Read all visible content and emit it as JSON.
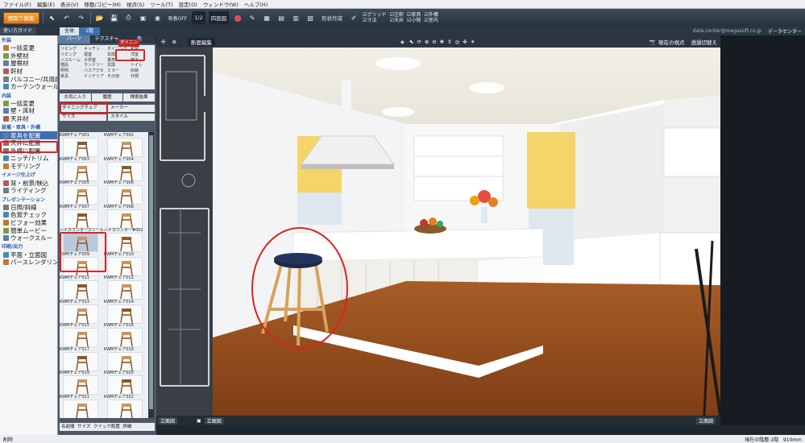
{
  "menu": [
    "ファイル(F)",
    "編集(E)",
    "表示(V)",
    "移動/コピー(M)",
    "視点(S)",
    "ツール(T)",
    "設定(O)",
    "ウィンドウ(W)",
    "ヘルプ(H)"
  ],
  "toolbar": {
    "plan_edit_button": "間取り編集",
    "grid_toggle": "吸着OFF",
    "scale": "1/2",
    "view_mode": "四面図",
    "shape_create": "形状作成",
    "display_options": [
      "グリッド",
      "注釈",
      "家具",
      "外構",
      "寸法",
      "天井",
      "小物",
      "室内"
    ]
  },
  "subbar": {
    "guide": "使い方ガイド",
    "tabs": [
      "全体",
      "1階"
    ],
    "email": "data.center@megasoft.co.jp",
    "data_center": "データセンター"
  },
  "leftnav": {
    "sections": [
      {
        "title": "外装",
        "items": [
          "一括変更",
          "外壁材",
          "屋根材",
          "軒材",
          "バルコニー/共用廊下",
          "カーテンウォール"
        ]
      },
      {
        "title": "内装",
        "items": [
          "一括変更",
          "壁・床材",
          "天井材"
        ]
      },
      {
        "title": "設備・家具・外構",
        "items": [
          "家具を配置",
          "天井に配置",
          "外構に配置",
          "ニッチ/トリム",
          "モデリング"
        ]
      },
      {
        "title": "イメージ仕上げ",
        "items": [
          "背・前景/映込",
          "ライティング"
        ]
      },
      {
        "title": "プレゼンテーション",
        "items": [
          "日照/斜線",
          "色覚チェック",
          "ビフォー効果",
          "簡単ムービー",
          "ウォークスルー"
        ]
      },
      {
        "title": "印刷/出力",
        "items": [
          "平面・立面図",
          "パースレンダリング"
        ]
      }
    ],
    "selected": "家具を配置"
  },
  "parts": {
    "tabs": [
      "パーツ",
      "テクスチャ",
      "色"
    ],
    "categories": [
      "リビング",
      "キッチン",
      "ダイニング",
      "和室",
      "リビング",
      "寝室",
      "玄関",
      "洋室",
      "バスルーム",
      "子供室",
      "書斎",
      "廊下",
      "階段",
      "ランドリー",
      "玄関",
      "トイレ",
      "照明",
      "バスアクセ",
      "ミラー",
      "収納",
      "家具",
      "インテリア",
      "その他",
      "外部"
    ],
    "active_category": "ダイニング",
    "subtabs": [
      "お気に入り",
      "履歴",
      "検索結果"
    ],
    "filter_type": "ダイニングチェア",
    "filter_maker": "メーカー",
    "filter_size": "サイズ",
    "filter_style": "スタイル",
    "items": [
      "KWMチェア001",
      "KWMチェア002",
      "KWMチェア003",
      "KWMチェア004",
      "KWMチェア005",
      "KWMチェア006",
      "KWMチェア007",
      "KWMチェア008",
      "ハイカウンタースツール",
      "ハイカウンター#002",
      "KWMチェア009",
      "KWMチェア010",
      "KWMチェア011",
      "KWMチェア012",
      "KWMチェア013",
      "KWMチェア014",
      "KWMチェア015",
      "KWMチェア016",
      "KWMチェア017",
      "KWMチェア018",
      "KWMチェア019",
      "KWMチェア020",
      "KWMチェア021",
      "KWMチェア022"
    ],
    "footer": [
      "名前順",
      "サイズ",
      "クイック配置",
      "詳細"
    ]
  },
  "view": {
    "plan_label": "断面編集",
    "viewpoint": "現在の視点",
    "extra": "透過切替え",
    "bottom_view_a": "立面図",
    "bottom_view_b": "立面図",
    "bottom_view_c": "立面図"
  },
  "status": {
    "left": "削除",
    "right": "現在の階層:1階",
    "dim": "910mm"
  },
  "colors": {
    "accent": "#f4a83a",
    "select": "#3d6fb4",
    "highlight": "#e02020"
  }
}
